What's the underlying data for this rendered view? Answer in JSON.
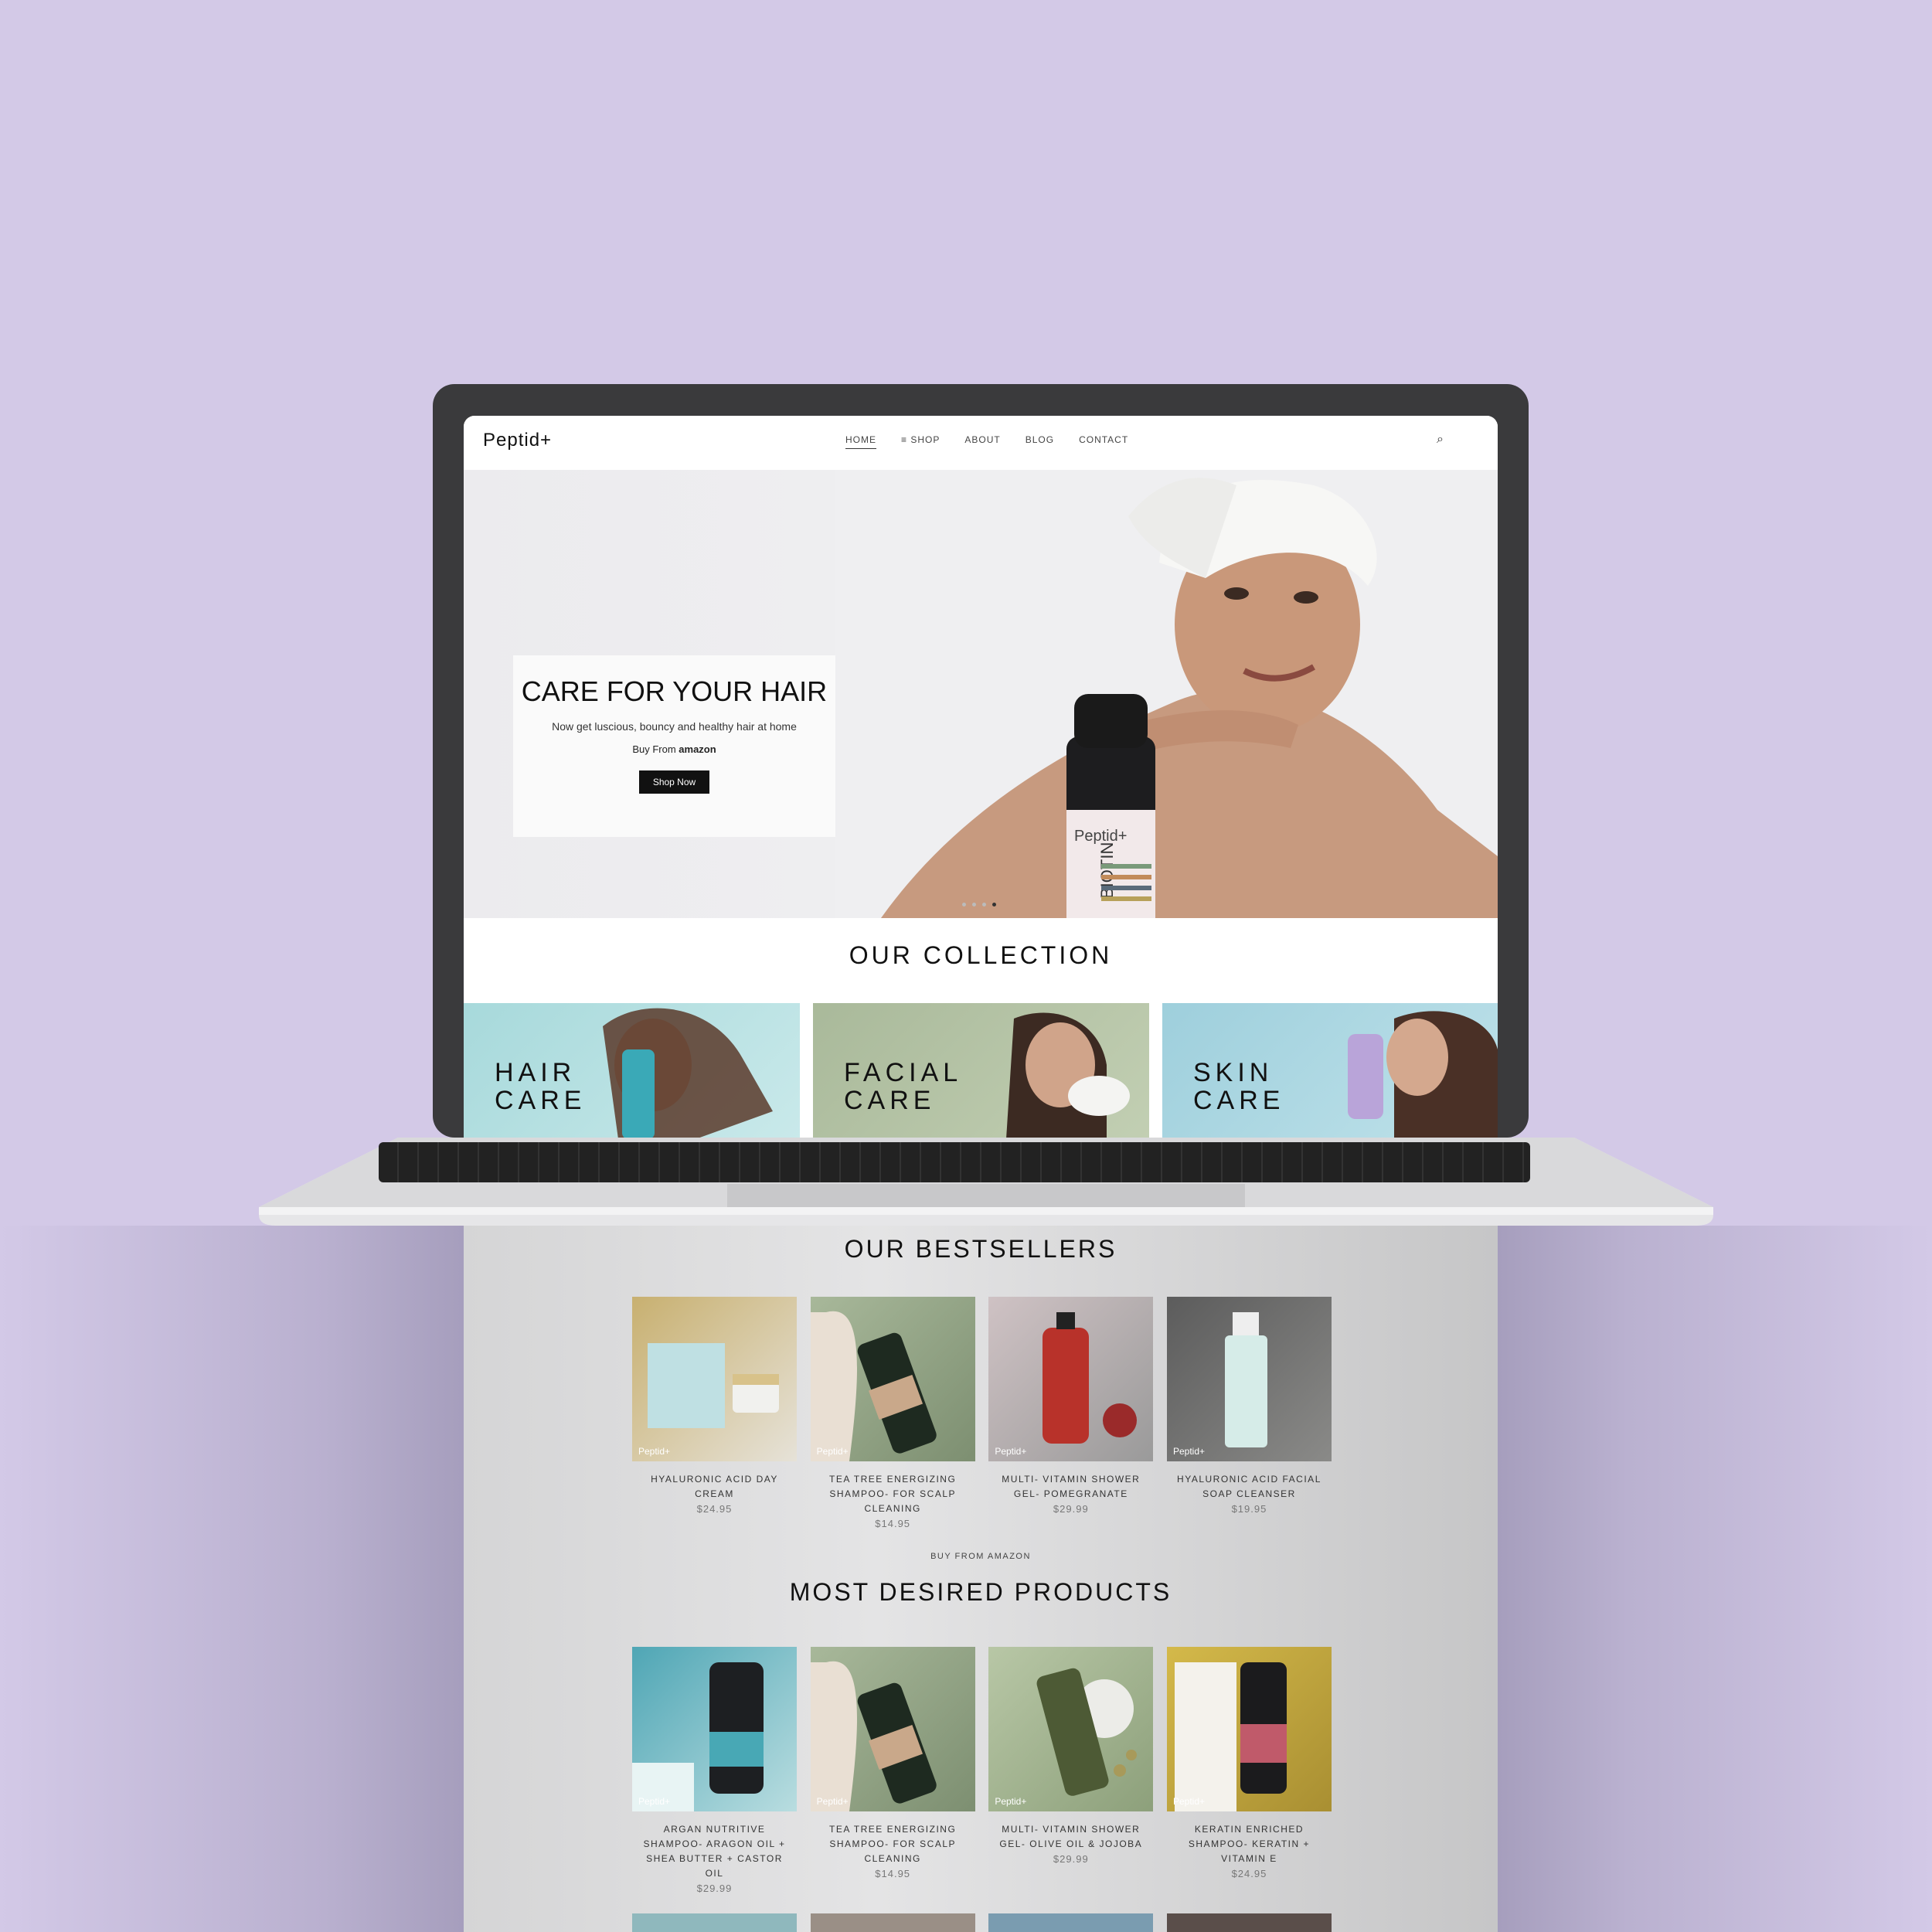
{
  "site": {
    "logo": "Peptid+",
    "nav": [
      "HOME",
      "SHOP",
      "ABOUT",
      "BLOG",
      "CONTACT"
    ],
    "nav_active": "HOME"
  },
  "hero": {
    "title": "CARE FOR YOUR HAIR",
    "subtitle": "Now get luscious, bouncy and healthy hair at home",
    "buy_prefix": "Buy From",
    "buy_brand": "amazon",
    "cta": "Shop Now",
    "product_label": "BIOTIN"
  },
  "collection": {
    "title": "OUR COLLECTION",
    "tiles": [
      {
        "line1": "HAIR",
        "line2": "CARE"
      },
      {
        "line1": "FACIAL",
        "line2": "CARE"
      },
      {
        "line1": "SKIN",
        "line2": "CARE"
      }
    ]
  },
  "bestsellers": {
    "title": "OUR BESTSELLERS",
    "items": [
      {
        "name": "HYALURONIC ACID DAY CREAM",
        "price": "$24.95"
      },
      {
        "name": "TEA TREE ENERGIZING SHAMPOO- FOR SCALP CLEANING",
        "price": "$14.95"
      },
      {
        "name": "MULTI- VITAMIN SHOWER GEL- POMEGRANATE",
        "price": "$29.99"
      },
      {
        "name": "HYALURONIC ACID FACIAL SOAP CLEANSER",
        "price": "$19.95"
      }
    ],
    "link": "BUY FROM AMAZON"
  },
  "desired": {
    "title": "MOST DESIRED PRODUCTS",
    "items": [
      {
        "name": "ARGAN NUTRITIVE SHAMPOO- ARAGON OIL + SHEA BUTTER + CASTOR OIL",
        "price": "$29.99"
      },
      {
        "name": "TEA TREE ENERGIZING SHAMPOO- FOR SCALP CLEANING",
        "price": "$14.95"
      },
      {
        "name": "MULTI- VITAMIN SHOWER GEL- OLIVE OIL & JOJOBA",
        "price": "$29.99"
      },
      {
        "name": "KERATIN ENRICHED SHAMPOO- KERATIN + VITAMIN E",
        "price": "$24.95"
      }
    ]
  },
  "image_brand": "Peptid+",
  "colors": {
    "background": "#d3c9e7",
    "button": "#111111",
    "laptop_bezel": "#3a3a3c"
  }
}
